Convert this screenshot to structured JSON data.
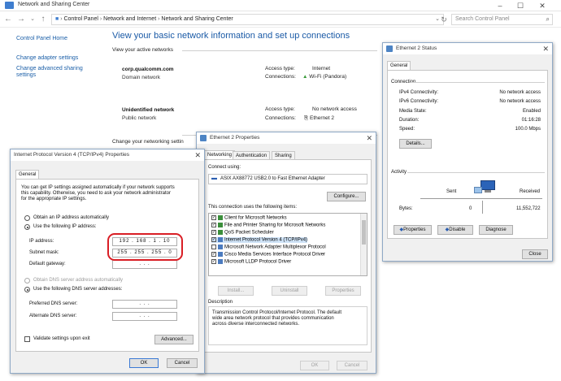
{
  "main": {
    "title": "Network and Sharing Center",
    "address": {
      "segments": [
        "Control Panel",
        "Network and Internet",
        "Network and Sharing Center"
      ],
      "separator": "›"
    },
    "search_placeholder": "Search Control Panel",
    "sidebar": [
      "Control Panel Home",
      "Change adapter settings",
      "Change advanced sharing",
      "settings"
    ],
    "heading": "View your basic network information and set up connections",
    "active_networks_label": "View your active networks",
    "networks": [
      {
        "name": "corp.qualcomm.com",
        "type": "Domain network",
        "access_label": "Access type:",
        "access_value": "Internet",
        "conn_label": "Connections:",
        "conn_value": "Wi-Fi (Pandora)"
      },
      {
        "name": "Unidentified network",
        "type": "Public network",
        "access_label": "Access type:",
        "access_value": "No network access",
        "conn_label": "Connections:",
        "conn_value": "Ethernet 2"
      }
    ],
    "change_settings_label": "Change your networking settin"
  },
  "ipv4": {
    "title": "Internet Protocol Version 4 (TCP/IPv4) Properties",
    "tab": "General",
    "intro": [
      "You can get IP settings assigned automatically if your network supports",
      "this capability. Otherwise, you need to ask your network administrator",
      "for the appropriate IP settings."
    ],
    "obtain_ip": "Obtain an IP address automatically",
    "use_ip": "Use the following IP address:",
    "ip_label": "IP address:",
    "ip_value": "192 . 168 . 1 . 10",
    "mask_label": "Subnet mask:",
    "mask_value": "255 . 255 . 255 . 0",
    "gateway_label": "Default gateway:",
    "gateway_value": ". . .",
    "obtain_dns": "Obtain DNS server address automatically",
    "use_dns": "Use the following DNS server addresses:",
    "pref_dns_label": "Preferred DNS server:",
    "alt_dns_label": "Alternate DNS server:",
    "dns_blank": ". . .",
    "validate": "Validate settings upon exit",
    "advanced": "Advanced...",
    "ok": "OK",
    "cancel": "Cancel"
  },
  "eth_props": {
    "title": "Ethernet 2 Properties",
    "tabs": [
      "Networking",
      "Authentication",
      "Sharing"
    ],
    "connect_using": "Connect using:",
    "adapter": "ASIX AX88772 USB2.0 to Fast Ethernet Adapter",
    "configure": "Configure...",
    "items_label": "This connection uses the following items:",
    "items": [
      {
        "check": "✓",
        "label": "Client for Microsoft Networks"
      },
      {
        "check": "✓",
        "label": "File and Printer Sharing for Microsoft Networks"
      },
      {
        "check": "✓",
        "label": "QoS Packet Scheduler"
      },
      {
        "check": "✓",
        "label": "Internet Protocol Version 4 (TCP/IPv4)"
      },
      {
        "check": "",
        "label": "Microsoft Network Adapter Multiplexor Protocol"
      },
      {
        "check": "✓",
        "label": "Cisco Media Services Interface Protocol Driver"
      },
      {
        "check": "✓",
        "label": "Microsoft LLDP Protocol Driver"
      }
    ],
    "install": "Install...",
    "uninstall": "Uninstall",
    "properties": "Properties",
    "description_label": "Description",
    "description": [
      "Transmission Control Protocol/Internet Protocol. The default",
      "wide area network protocol that provides communication",
      "across diverse interconnected networks."
    ],
    "ok": "OK",
    "cancel": "Cancel"
  },
  "eth_status": {
    "title": "Ethernet 2 Status",
    "tab": "General",
    "connection_label": "Connection",
    "rows": [
      {
        "label": "IPv4 Connectivity:",
        "value": "No network access"
      },
      {
        "label": "IPv6 Connectivity:",
        "value": "No network access"
      },
      {
        "label": "Media State:",
        "value": "Enabled"
      },
      {
        "label": "Duration:",
        "value": "01:16:28"
      },
      {
        "label": "Speed:",
        "value": "100.0 Mbps"
      }
    ],
    "details": "Details...",
    "activity_label": "Activity",
    "sent_label": "Sent",
    "received_label": "Received",
    "bytes_label": "Bytes:",
    "bytes_sent": "0",
    "bytes_received": "11,552,722",
    "properties": "Properties",
    "disable": "Disable",
    "diagnose": "Diagnose",
    "close": "Close"
  }
}
